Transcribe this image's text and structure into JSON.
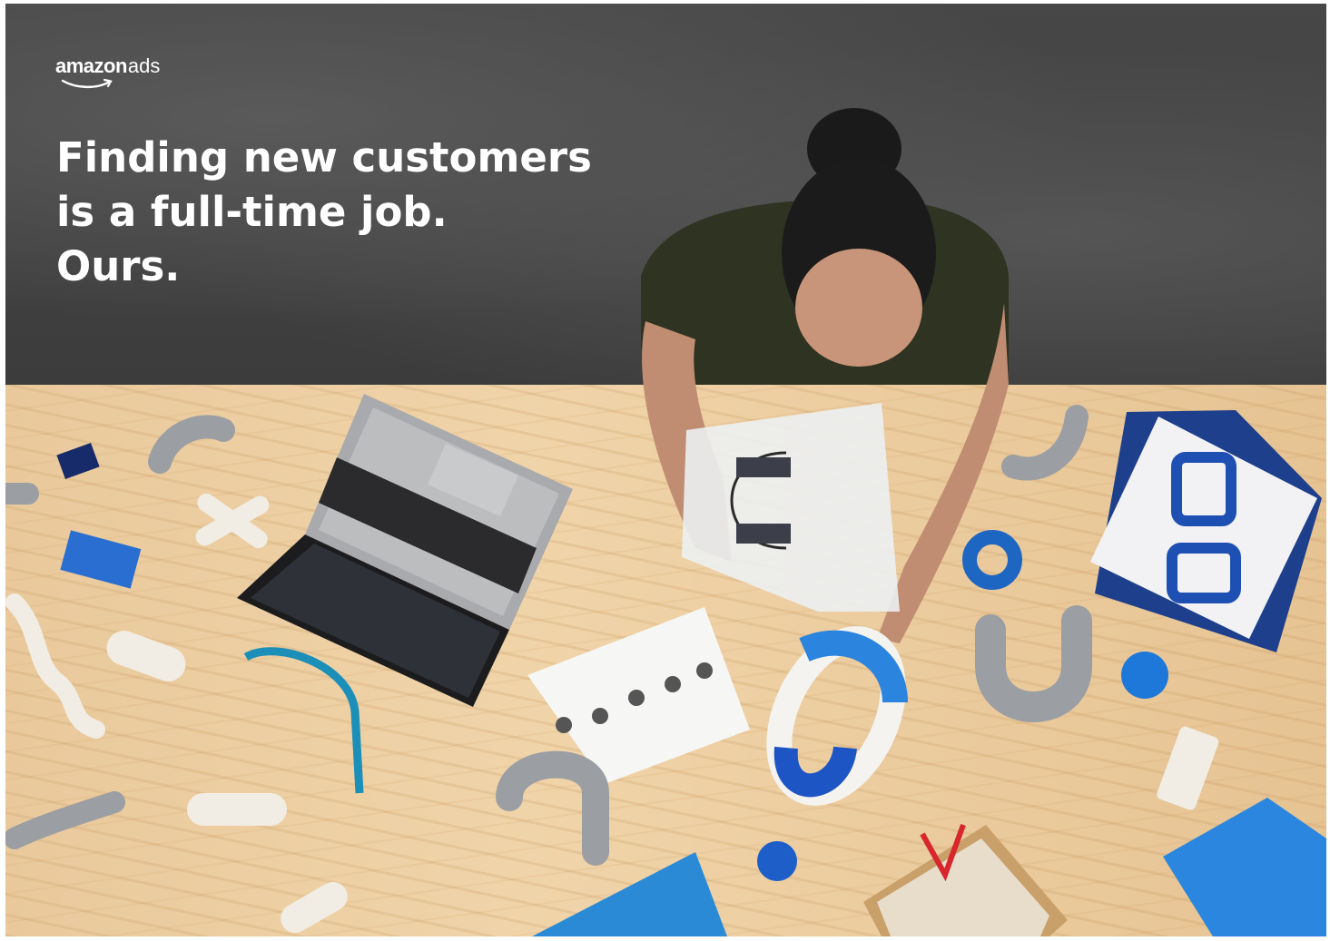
{
  "brand": {
    "logo_text_main": "amazon",
    "logo_text_suffix": "ads"
  },
  "headline": {
    "lines": [
      "Finding new customers",
      "is a full-time job.",
      "Ours."
    ]
  },
  "colors": {
    "wall": "#434343",
    "table": "#ecd0a2",
    "accent_blue": "#1f6fd1",
    "teal": "#2a8fb5",
    "headline_text": "#ffffff"
  },
  "icons": [
    "amazon-smile-logo"
  ]
}
